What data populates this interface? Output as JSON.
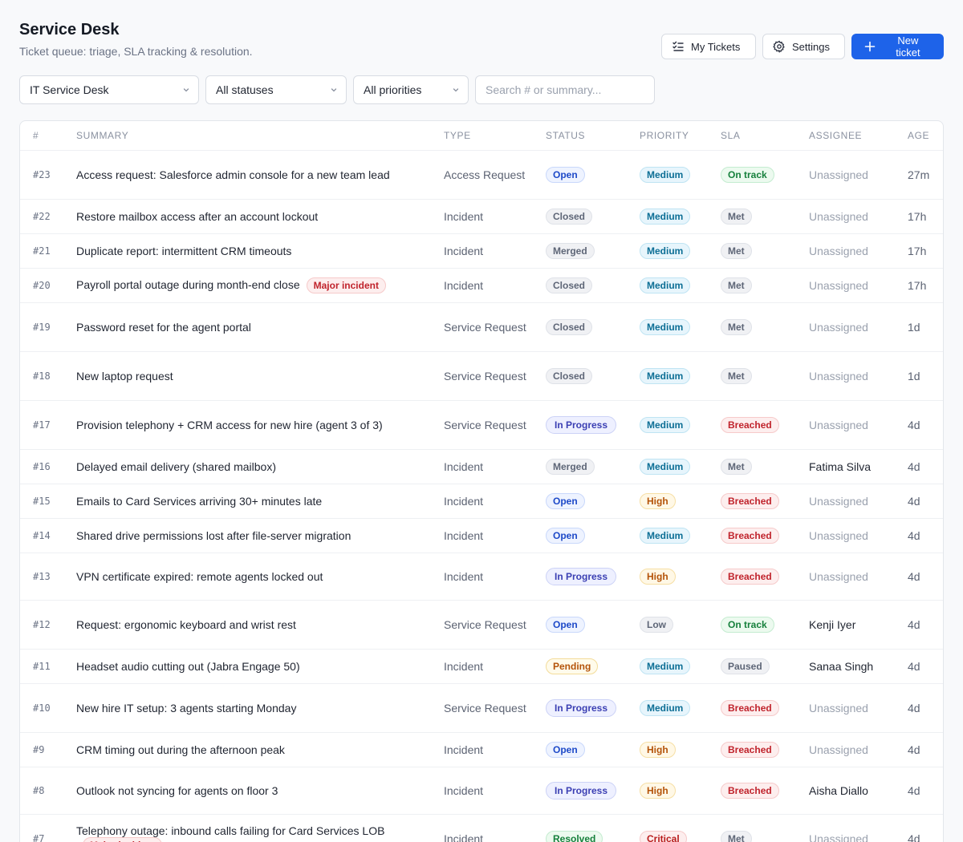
{
  "header": {
    "title": "Service Desk",
    "subtitle": "Ticket queue: triage, SLA tracking & resolution.",
    "my_tickets_label": "My Tickets",
    "settings_label": "Settings",
    "new_ticket_label": "New ticket"
  },
  "filters": {
    "desk": "IT Service Desk",
    "status": "All statuses",
    "priority": "All priorities",
    "search_placeholder": "Search # or summary..."
  },
  "table": {
    "columns": [
      "#",
      "SUMMARY",
      "TYPE",
      "STATUS",
      "PRIORITY",
      "SLA",
      "ASSIGNEE",
      "AGE"
    ],
    "rows": [
      {
        "num": "#23",
        "summary": "Access request: Salesforce admin console for a new team lead",
        "tag": "",
        "type": "Access Request",
        "status": "Open",
        "priority": "Medium",
        "sla": "On track",
        "assignee": "Unassigned",
        "age": "27m"
      },
      {
        "num": "#22",
        "summary": "Restore mailbox access after an account lockout",
        "tag": "",
        "type": "Incident",
        "status": "Closed",
        "priority": "Medium",
        "sla": "Met",
        "assignee": "Unassigned",
        "age": "17h"
      },
      {
        "num": "#21",
        "summary": "Duplicate report: intermittent CRM timeouts",
        "tag": "",
        "type": "Incident",
        "status": "Merged",
        "priority": "Medium",
        "sla": "Met",
        "assignee": "Unassigned",
        "age": "17h"
      },
      {
        "num": "#20",
        "summary": "Payroll portal outage during month-end close",
        "tag": "Major incident",
        "type": "Incident",
        "status": "Closed",
        "priority": "Medium",
        "sla": "Met",
        "assignee": "Unassigned",
        "age": "17h"
      },
      {
        "num": "#19",
        "summary": "Password reset for the agent portal",
        "tag": "",
        "type": "Service Request",
        "status": "Closed",
        "priority": "Medium",
        "sla": "Met",
        "assignee": "Unassigned",
        "age": "1d"
      },
      {
        "num": "#18",
        "summary": "New laptop request",
        "tag": "",
        "type": "Service Request",
        "status": "Closed",
        "priority": "Medium",
        "sla": "Met",
        "assignee": "Unassigned",
        "age": "1d"
      },
      {
        "num": "#17",
        "summary": "Provision telephony + CRM access for new hire (agent 3 of 3)",
        "tag": "",
        "type": "Service Request",
        "status": "In Progress",
        "priority": "Medium",
        "sla": "Breached",
        "assignee": "Unassigned",
        "age": "4d"
      },
      {
        "num": "#16",
        "summary": "Delayed email delivery (shared mailbox)",
        "tag": "",
        "type": "Incident",
        "status": "Merged",
        "priority": "Medium",
        "sla": "Met",
        "assignee": "Fatima Silva",
        "age": "4d"
      },
      {
        "num": "#15",
        "summary": "Emails to Card Services arriving 30+ minutes late",
        "tag": "",
        "type": "Incident",
        "status": "Open",
        "priority": "High",
        "sla": "Breached",
        "assignee": "Unassigned",
        "age": "4d"
      },
      {
        "num": "#14",
        "summary": "Shared drive permissions lost after file-server migration",
        "tag": "",
        "type": "Incident",
        "status": "Open",
        "priority": "Medium",
        "sla": "Breached",
        "assignee": "Unassigned",
        "age": "4d"
      },
      {
        "num": "#13",
        "summary": "VPN certificate expired: remote agents locked out",
        "tag": "",
        "type": "Incident",
        "status": "In Progress",
        "priority": "High",
        "sla": "Breached",
        "assignee": "Unassigned",
        "age": "4d"
      },
      {
        "num": "#12",
        "summary": "Request: ergonomic keyboard and wrist rest",
        "tag": "",
        "type": "Service Request",
        "status": "Open",
        "priority": "Low",
        "sla": "On track",
        "assignee": "Kenji Iyer",
        "age": "4d"
      },
      {
        "num": "#11",
        "summary": "Headset audio cutting out (Jabra Engage 50)",
        "tag": "",
        "type": "Incident",
        "status": "Pending",
        "priority": "Medium",
        "sla": "Paused",
        "assignee": "Sanaa Singh",
        "age": "4d"
      },
      {
        "num": "#10",
        "summary": "New hire IT setup: 3 agents starting Monday",
        "tag": "",
        "type": "Service Request",
        "status": "In Progress",
        "priority": "Medium",
        "sla": "Breached",
        "assignee": "Unassigned",
        "age": "4d"
      },
      {
        "num": "#9",
        "summary": "CRM timing out during the afternoon peak",
        "tag": "",
        "type": "Incident",
        "status": "Open",
        "priority": "High",
        "sla": "Breached",
        "assignee": "Unassigned",
        "age": "4d"
      },
      {
        "num": "#8",
        "summary": "Outlook not syncing for agents on floor 3",
        "tag": "",
        "type": "Incident",
        "status": "In Progress",
        "priority": "High",
        "sla": "Breached",
        "assignee": "Aisha Diallo",
        "age": "4d"
      },
      {
        "num": "#7",
        "summary": "Telephony outage: inbound calls failing for Card Services LOB",
        "tag": "Major incident",
        "type": "Incident",
        "status": "Resolved",
        "priority": "Critical",
        "sla": "Met",
        "assignee": "Unassigned",
        "age": "4d"
      }
    ]
  },
  "colors": {
    "accent": "#1e63e9",
    "background": "#f8f9fb"
  },
  "icons": {
    "my_tickets": "checklist-icon",
    "settings": "gear-icon",
    "new_ticket": "plus-icon",
    "select": "chevron-down-icon"
  }
}
